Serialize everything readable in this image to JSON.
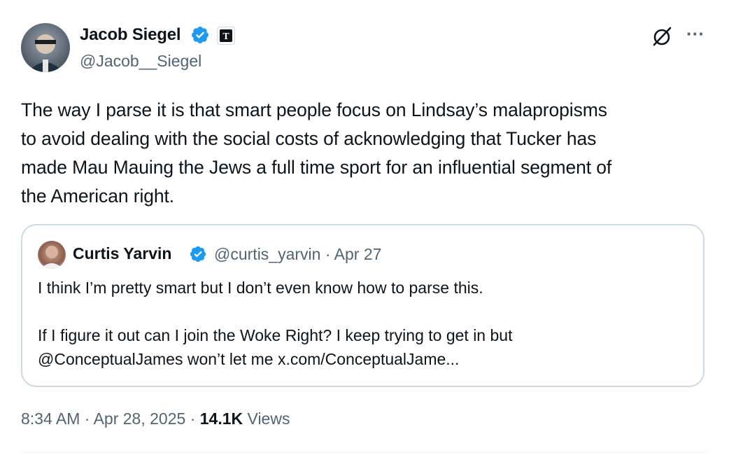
{
  "author": {
    "name": "Jacob Siegel",
    "handle": "@Jacob__Siegel",
    "verified_color": "#1d9bf0",
    "affiliation_badge_letter": "T"
  },
  "icons": {
    "grok": "grok-icon",
    "more": "more-options-icon",
    "more_glyph": "···"
  },
  "tweet": {
    "lines": [
      "The way I parse it is that smart people focus on Lindsay’s malapropisms",
      "to avoid dealing with the social costs of acknowledging that Tucker has",
      "made Mau Mauing the Jews a full time sport for an influential segment of",
      "the American right."
    ]
  },
  "quote": {
    "name": "Curtis Yarvin",
    "handle": "@curtis_yarvin",
    "separator": "·",
    "date": "Apr 27",
    "line1": "I think I’m pretty smart but I don’t even know how to parse this.",
    "line2": "If I figure it out can I join the Woke Right? I keep trying to get in but",
    "line3": "@ConceptualJames won’t let me x.com/ConceptualJame..."
  },
  "footer": {
    "time": "8:34 AM",
    "separator": "·",
    "date": "Apr 28, 2025",
    "views_count": "14.1K",
    "views_label": "Views"
  },
  "colors": {
    "text": "#0f1419",
    "secondary": "#536471",
    "border": "#cfd9de",
    "accent": "#1d9bf0"
  }
}
